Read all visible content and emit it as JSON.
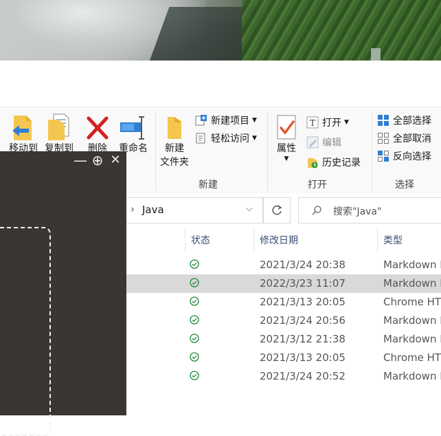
{
  "ribbon": {
    "move_to": "移动到",
    "copy_to": "复制到",
    "delete": "删除",
    "rename": "重命名",
    "new_folder_line1": "新建",
    "new_folder_line2": "文件夹",
    "new_item": "新建项目",
    "easy_access": "轻松访问",
    "group_new": "新建",
    "properties": "属性",
    "open": "打开",
    "edit": "编辑",
    "history": "历史记录",
    "group_open": "打开",
    "select_all": "全部选择",
    "select_none": "全部取消",
    "invert_selection": "反向选择",
    "group_select": "选择"
  },
  "address": {
    "crumb_separator": "›",
    "current_folder": "Java",
    "search_placeholder": "搜索\"Java\""
  },
  "columns": {
    "status": "状态",
    "modified": "修改日期",
    "type": "类型"
  },
  "rows": [
    {
      "date": "2021/3/24 20:38",
      "type": "Markdown F",
      "selected": false
    },
    {
      "date": "2022/3/23 11:07",
      "type": "Markdown F",
      "selected": true
    },
    {
      "date": "2021/3/13 20:05",
      "type": "Chrome HT",
      "selected": false
    },
    {
      "date": "2021/3/24 20:56",
      "type": "Markdown F",
      "selected": false
    },
    {
      "date": "2021/3/12 21:38",
      "type": "Markdown F",
      "selected": false
    },
    {
      "date": "2021/3/13 20:05",
      "type": "Chrome HT",
      "selected": false
    },
    {
      "date": "2021/3/24 20:52",
      "type": "Markdown F",
      "selected": false
    }
  ],
  "overlay": {
    "minimize_symbol": "—",
    "zoom_symbol": "⊕",
    "close_symbol": "✕"
  },
  "icons": {
    "status": "synced-check-icon",
    "refresh": "refresh-icon",
    "search": "search-icon"
  },
  "colors": {
    "status_green": "#1e8a3a",
    "overlay_bg": "#3a3631",
    "selected_row": "#d9d9d9",
    "header_text": "#3a4f74"
  }
}
